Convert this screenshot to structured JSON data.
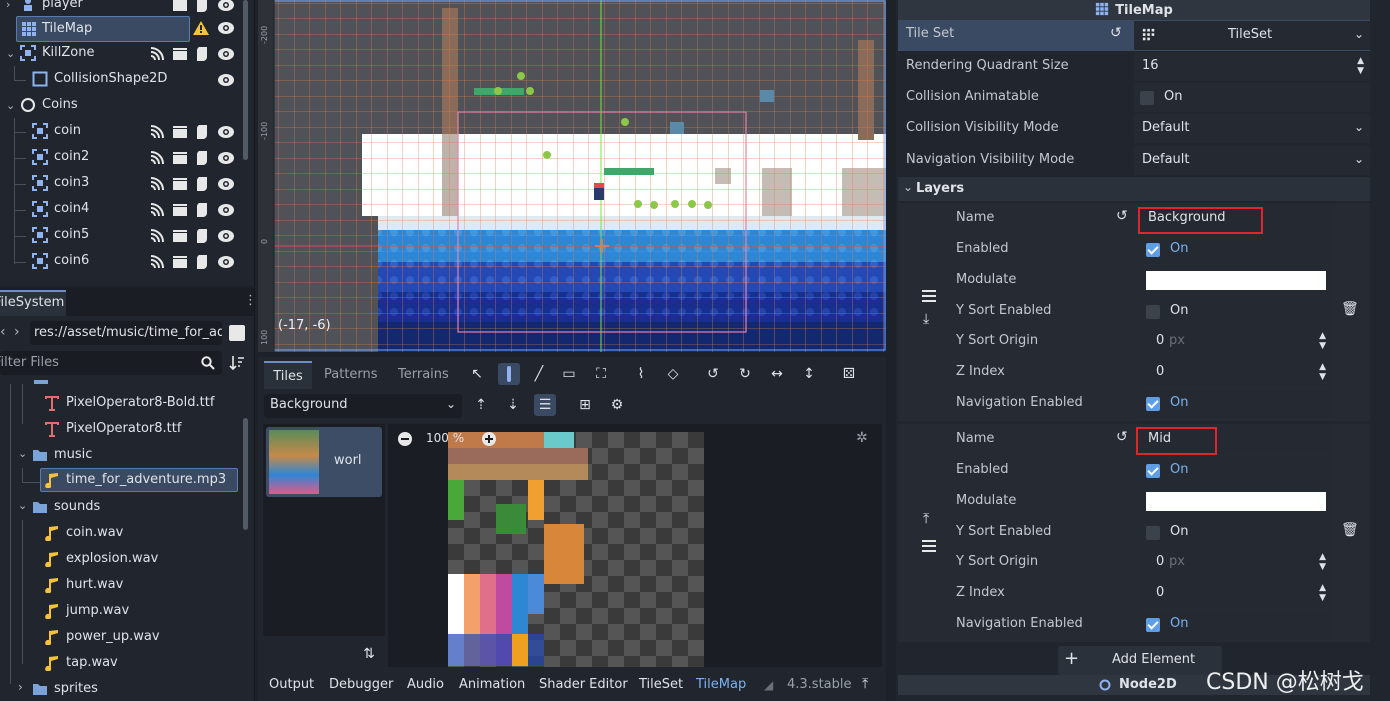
{
  "scene_tree": {
    "nodes": [
      {
        "label": "player",
        "icon": "player-icon"
      },
      {
        "label": "TileMap",
        "icon": "tilemap-icon",
        "warning": true
      },
      {
        "label": "KillZone",
        "icon": "area-icon"
      },
      {
        "label": "CollisionShape2D",
        "icon": "collision-shape-icon"
      },
      {
        "label": "Coins",
        "icon": "node2d-icon"
      },
      {
        "label": "coin",
        "icon": "area-icon"
      },
      {
        "label": "coin2",
        "icon": "area-icon"
      },
      {
        "label": "coin3",
        "icon": "area-icon"
      },
      {
        "label": "coin4",
        "icon": "area-icon"
      },
      {
        "label": "coin5",
        "icon": "area-icon"
      },
      {
        "label": "coin6",
        "icon": "area-icon"
      }
    ]
  },
  "filesystem": {
    "tab_label": "FileSystem",
    "path": "res://asset/music/time_for_ad",
    "filter_placeholder": "Filter Files",
    "items": [
      {
        "label": "PixelOperator8-Bold.ttf",
        "type": "font"
      },
      {
        "label": "PixelOperator8.ttf",
        "type": "font"
      },
      {
        "label": "music",
        "type": "folder"
      },
      {
        "label": "time_for_adventure.mp3",
        "type": "audio",
        "selected": true
      },
      {
        "label": "sounds",
        "type": "folder"
      },
      {
        "label": "coin.wav",
        "type": "audio"
      },
      {
        "label": "explosion.wav",
        "type": "audio"
      },
      {
        "label": "hurt.wav",
        "type": "audio"
      },
      {
        "label": "jump.wav",
        "type": "audio"
      },
      {
        "label": "power_up.wav",
        "type": "audio"
      },
      {
        "label": "tap.wav",
        "type": "audio"
      },
      {
        "label": "sprites",
        "type": "folder"
      }
    ]
  },
  "viewport": {
    "coordinates": "(-17, -6)",
    "ruler_marks": [
      "-200",
      "-100",
      "0",
      "100"
    ]
  },
  "tiles_panel": {
    "tabs": [
      "Tiles",
      "Patterns",
      "Terrains"
    ],
    "active_tab": "Tiles",
    "layer_select": "Background",
    "atlas_item_label": "worl",
    "zoom": "100 %"
  },
  "dock_bar": {
    "items": [
      "Output",
      "Debugger",
      "Audio",
      "Animation",
      "Shader Editor",
      "TileSet",
      "TileMap"
    ],
    "active": "TileMap",
    "version": "4.3.stable"
  },
  "inspector": {
    "header": "TileMap",
    "properties": [
      {
        "name": "Tile Set",
        "value": "TileSet",
        "kind": "resource"
      },
      {
        "name": "Rendering Quadrant Size",
        "value": "16",
        "kind": "spin"
      },
      {
        "name": "Collision Animatable",
        "value": "On",
        "kind": "check",
        "checked": false
      },
      {
        "name": "Collision Visibility Mode",
        "value": "Default",
        "kind": "dropdown"
      },
      {
        "name": "Navigation Visibility Mode",
        "value": "Default",
        "kind": "dropdown"
      }
    ],
    "layers_label": "Layers",
    "layers": [
      {
        "name": "Background",
        "fields": [
          {
            "name": "Name",
            "value": "Background",
            "kind": "text"
          },
          {
            "name": "Enabled",
            "value": "On",
            "kind": "check",
            "checked": true
          },
          {
            "name": "Modulate",
            "value": "",
            "kind": "color",
            "color": "#ffffff"
          },
          {
            "name": "Y Sort Enabled",
            "value": "On",
            "kind": "check",
            "checked": false
          },
          {
            "name": "Y Sort Origin",
            "value": "0",
            "unit": "px",
            "kind": "spin"
          },
          {
            "name": "Z Index",
            "value": "0",
            "kind": "spin"
          },
          {
            "name": "Navigation Enabled",
            "value": "On",
            "kind": "check",
            "checked": true
          }
        ]
      },
      {
        "name": "Mid",
        "fields": [
          {
            "name": "Name",
            "value": "Mid",
            "kind": "text"
          },
          {
            "name": "Enabled",
            "value": "On",
            "kind": "check",
            "checked": true
          },
          {
            "name": "Modulate",
            "value": "",
            "kind": "color",
            "color": "#ffffff"
          },
          {
            "name": "Y Sort Enabled",
            "value": "On",
            "kind": "check",
            "checked": false
          },
          {
            "name": "Y Sort Origin",
            "value": "0",
            "unit": "px",
            "kind": "spin"
          },
          {
            "name": "Z Index",
            "value": "0",
            "kind": "spin"
          },
          {
            "name": "Navigation Enabled",
            "value": "On",
            "kind": "check",
            "checked": true
          }
        ]
      }
    ],
    "add_element": "Add Element",
    "footer_node": "Node2D"
  },
  "watermark": "CSDN @松树戈",
  "colors": {
    "accent": "#6d8dc2",
    "check_blue": "#5e9ee5",
    "highlight_box": "#e0262c",
    "warning": "#f5c33b"
  }
}
